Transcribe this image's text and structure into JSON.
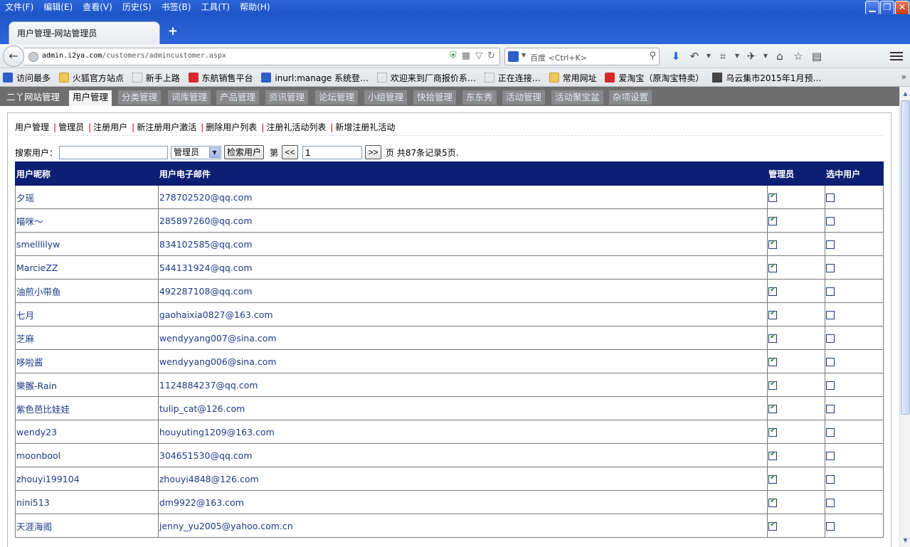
{
  "browser": {
    "menu": [
      "文件(F)",
      "编辑(E)",
      "查看(V)",
      "历史(S)",
      "书签(B)",
      "工具(T)",
      "帮助(H)"
    ],
    "tab_title": "用户管理-网站管理员",
    "new_tab": "+",
    "url_host": "admin.i2ya.com",
    "url_path": "/customers/admincustomer.aspx",
    "search_placeholder": "百度 <Ctrl+K>",
    "bookmarks": [
      "访问最多",
      "火狐官方站点",
      "新手上路",
      "东航销售平台",
      "inurl:manage 系统登…",
      "欢迎来到厂商报价系…",
      "正在连接…",
      "常用网址",
      "爱淘宝（原淘宝特卖）",
      "乌云集市2015年1月预…"
    ],
    "bookmarks_more": "»"
  },
  "site": {
    "nav": [
      "二丫网站管理",
      "用户管理",
      "分类管理",
      "词库管理",
      "产品管理",
      "资讯管理",
      "论坛管理",
      "小组管理",
      "快拾管理",
      "东东秀",
      "活动管理",
      "活动聚宝盆",
      "杂项设置"
    ],
    "active_nav": "用户管理",
    "subnav": [
      "用户管理",
      "管理员",
      "注册用户",
      "新注册用户激活",
      "删除用户列表",
      "注册礼活动列表",
      "新增注册礼活动"
    ]
  },
  "search": {
    "label": "搜索用户：",
    "value": "",
    "role": "管理员",
    "button": "检索用户",
    "page_prefix": "第",
    "prev": "<<",
    "page_value": "1",
    "next": ">>",
    "summary": "页 共87条记录5页."
  },
  "table": {
    "headers": [
      "用户昵称",
      "用户电子邮件",
      "管理员",
      "选中用户"
    ],
    "rows": [
      {
        "nick": "夕瑶",
        "email": "278702520@qq.com",
        "admin": true,
        "selected": false
      },
      {
        "nick": "喵咪～",
        "email": "285897260@qq.com",
        "admin": true,
        "selected": false
      },
      {
        "nick": "smelllilyw",
        "email": "834102585@qq.com",
        "admin": true,
        "selected": false
      },
      {
        "nick": "MarcieZZ",
        "email": "544131924@qq.com",
        "admin": true,
        "selected": false
      },
      {
        "nick": "油煎小带鱼",
        "email": "492287108@qq.com",
        "admin": true,
        "selected": false
      },
      {
        "nick": "七月",
        "email": "gaohaixia0827@163.com",
        "admin": true,
        "selected": false
      },
      {
        "nick": "芝麻",
        "email": "wendyyang007@sina.com",
        "admin": true,
        "selected": false
      },
      {
        "nick": "哆啦酱",
        "email": "wendyyang006@sina.com",
        "admin": true,
        "selected": false
      },
      {
        "nick": "樂翭-Rain",
        "email": "1124884237@qq.com",
        "admin": true,
        "selected": false
      },
      {
        "nick": "紫色芭比娃娃",
        "email": "tulip_cat@126.com",
        "admin": true,
        "selected": false
      },
      {
        "nick": "wendy23",
        "email": "houyuting1209@163.com",
        "admin": true,
        "selected": false
      },
      {
        "nick": "moonbool",
        "email": "304651530@qq.com",
        "admin": true,
        "selected": false
      },
      {
        "nick": "zhouyi199104",
        "email": "zhouyi4848@126.com",
        "admin": true,
        "selected": false
      },
      {
        "nick": "nini513",
        "email": "dm9922@163.com",
        "admin": true,
        "selected": false
      },
      {
        "nick": "天涯海阁",
        "email": "jenny_yu2005@yahoo.com.cn",
        "admin": true,
        "selected": false
      }
    ]
  }
}
